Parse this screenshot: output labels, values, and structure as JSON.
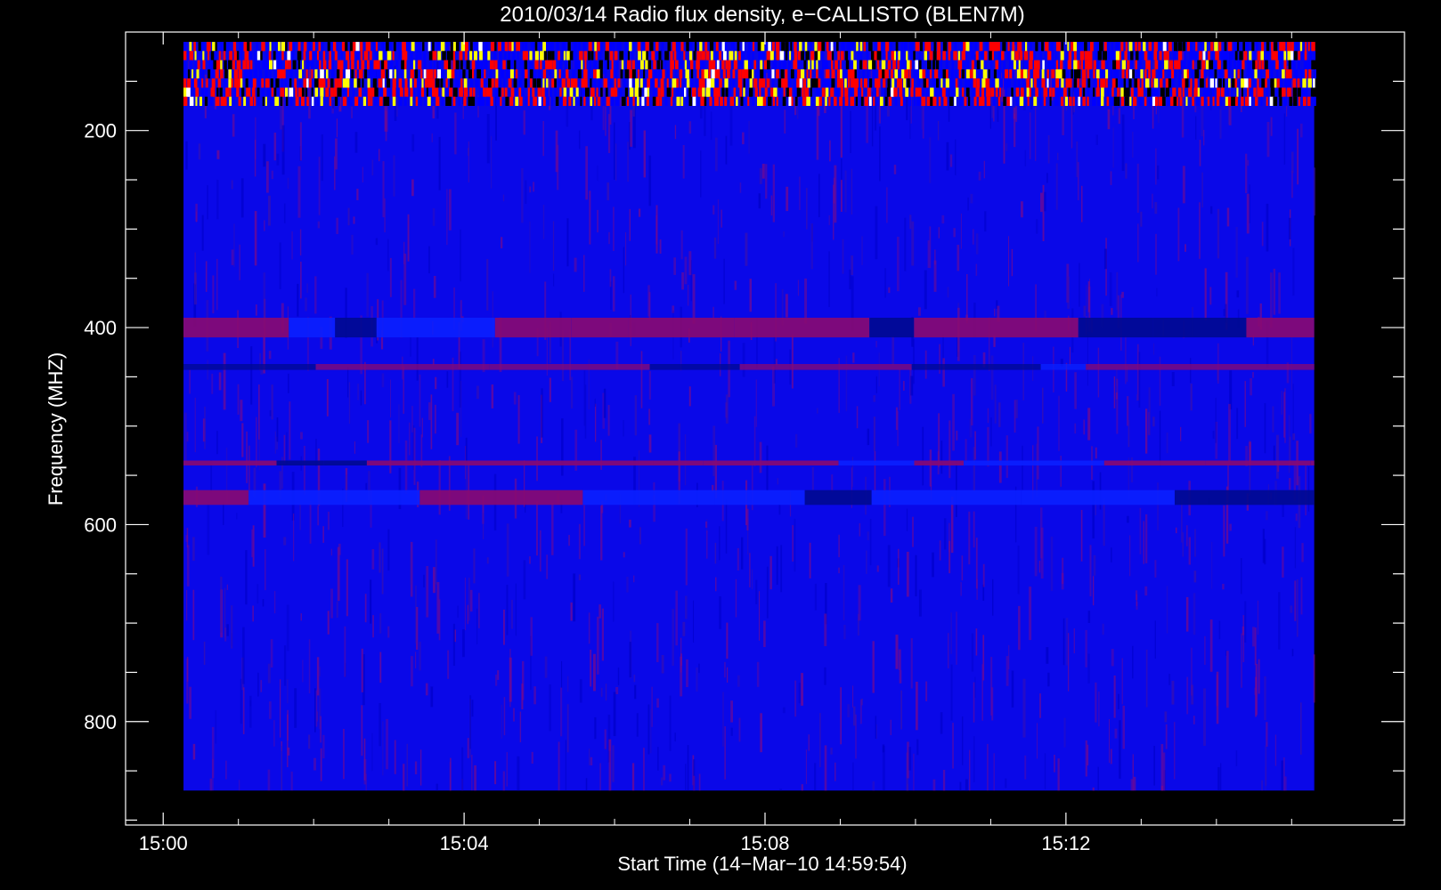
{
  "chart_data": {
    "type": "heatmap",
    "title": "2010/03/14  Radio flux density, e−CALLISTO (BLEN7M)",
    "xlabel": "Start Time (14−Mar−10 14:59:54)",
    "ylabel": "Frequency (MHZ)",
    "x_ticks": [
      {
        "value": 0,
        "label": "15:00"
      },
      {
        "value": 4,
        "label": "15:04"
      },
      {
        "value": 8,
        "label": "15:08"
      },
      {
        "value": 12,
        "label": "15:12"
      }
    ],
    "y_ticks": [
      {
        "value": 200,
        "label": "200"
      },
      {
        "value": 400,
        "label": "400"
      },
      {
        "value": 600,
        "label": "600"
      },
      {
        "value": 800,
        "label": "800"
      }
    ],
    "x_range_minutes_after_1500": [
      -0.5,
      16.5
    ],
    "y_range_mhz": [
      100,
      905
    ],
    "data_x_range_minutes_after_1500": [
      0.27,
      15.3
    ],
    "data_y_range_mhz": [
      110,
      870
    ],
    "y_axis_inverted": true,
    "colormap": [
      "#000000",
      "#0000ff",
      "#ff0000",
      "#ffff00",
      "#ffffff"
    ],
    "background": "#0a08e8",
    "features": [
      {
        "name": "RFI band",
        "freq_mhz": [
          110,
          175
        ],
        "intensity": "high"
      },
      {
        "name": "400 MHz line",
        "freq_mhz": [
          390,
          410
        ],
        "intensity": "medium"
      },
      {
        "name": "440 MHz line",
        "freq_mhz": [
          437,
          443
        ],
        "intensity": "low"
      },
      {
        "name": "537 MHz line",
        "freq_mhz": [
          535,
          540
        ],
        "intensity": "medium"
      },
      {
        "name": "575 MHz band",
        "freq_mhz": [
          565,
          580
        ],
        "intensity": "medium"
      }
    ]
  }
}
